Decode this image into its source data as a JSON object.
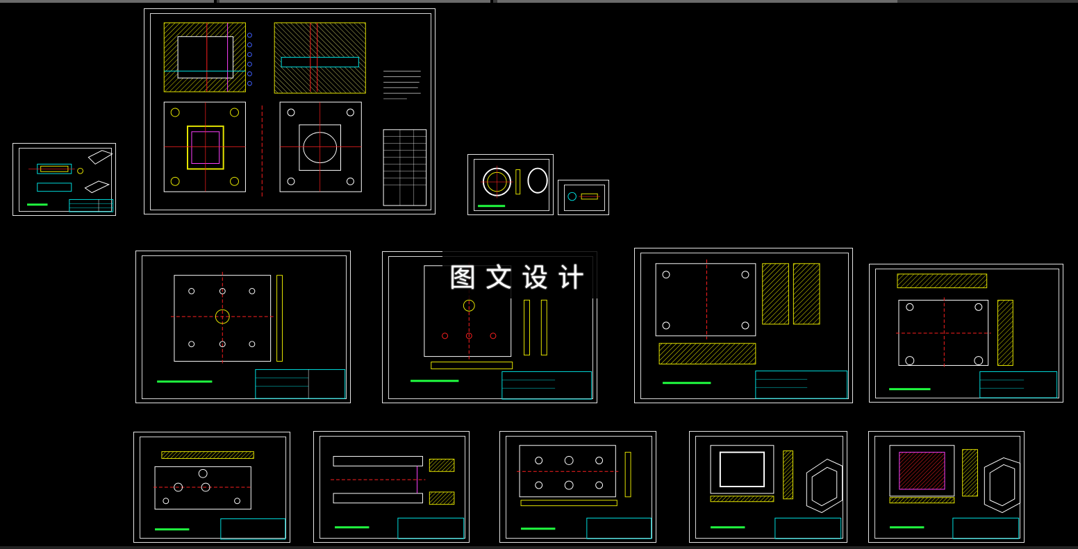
{
  "app": {
    "watermark_text": "图文设计"
  },
  "colors": {
    "background": "#000000",
    "sheet_border": "#e6e6e6",
    "drawing_yellow": "#e6e600",
    "drawing_cyan": "#00e0e0",
    "drawing_red": "#ff2020",
    "drawing_green": "#20ff40",
    "drawing_white": "#ffffff",
    "drawing_magenta": "#ff40ff",
    "drawing_blue": "#4060ff"
  },
  "sheets": [
    {
      "id": "part-drawing-small",
      "kind": "part"
    },
    {
      "id": "assembly-drawing",
      "kind": "assembly"
    },
    {
      "id": "ring-part-drawing",
      "kind": "ring"
    },
    {
      "id": "small-detail-drawing",
      "kind": "tiny"
    },
    {
      "id": "fixed-plate-drawing",
      "kind": "plate"
    },
    {
      "id": "moving-plate-drawing",
      "kind": "plate"
    },
    {
      "id": "cavity-plate-drawing",
      "kind": "plate"
    },
    {
      "id": "support-plate-drawing",
      "kind": "plate"
    },
    {
      "id": "push-plate-drawing",
      "kind": "plate"
    },
    {
      "id": "ejector-plate-drawing",
      "kind": "plate"
    },
    {
      "id": "stripper-plate-drawing",
      "kind": "plate"
    },
    {
      "id": "core-insert-drawing",
      "kind": "insert"
    },
    {
      "id": "cavity-insert-drawing",
      "kind": "insert"
    }
  ]
}
